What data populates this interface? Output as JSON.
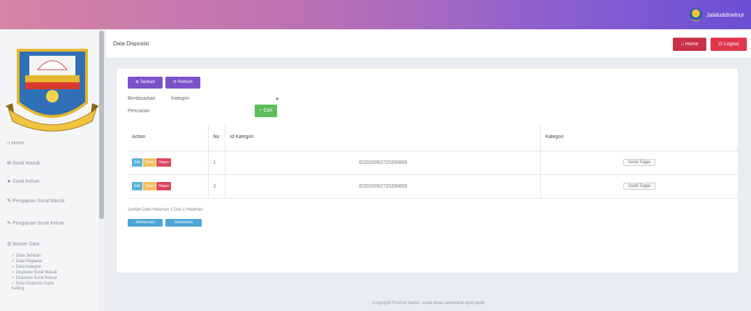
{
  "header": {
    "username": "Jalaluddinelnur"
  },
  "sidebar": {
    "nav": [
      {
        "label": "Home"
      },
      {
        "label": "Surat Masuk"
      },
      {
        "label": "Surat Keluar"
      },
      {
        "label": "Pengajuan Surat Masuk"
      },
      {
        "label": "Pengajuan Surat Keluar"
      },
      {
        "label": "Master Data"
      }
    ],
    "sub": [
      {
        "label": "Data Jabatan"
      },
      {
        "label": "Data Pegawai"
      },
      {
        "label": "Data Kategori"
      },
      {
        "label": "Disposisi Surat Masuk"
      },
      {
        "label": "Disposisi Surat Keluar"
      },
      {
        "label": "Data Disposisi Surat"
      },
      {
        "label": "Setting"
      }
    ]
  },
  "page": {
    "title": "Data Disposisi",
    "home_label": "Home",
    "logout_label": "Logout"
  },
  "toolbar": {
    "tambah_label": "Tambah",
    "refresh_label": "Refresh"
  },
  "filter": {
    "berdasarkan_label": "Berdasarkan",
    "selected": "Kategori",
    "pencarian_label": "Pencarian",
    "cari_label": "Cari"
  },
  "table": {
    "headers": [
      "Action",
      "No",
      "Id Kategori",
      "Kategori"
    ],
    "action_labels": {
      "edit": "Edit",
      "detail": "Detail",
      "delete": "Hapus"
    },
    "rows": [
      {
        "no": "1",
        "id": "ID2020062720200805",
        "kategori": "Surat Tugas"
      },
      {
        "no": "2",
        "id": "ID2020062720200805",
        "kategori": "Surat Tugas"
      }
    ]
  },
  "footer": {
    "summary": "Jumlah Data Halaman 1 Dari 1 Halaman",
    "prev_label": "Sebelumnya",
    "next_label": "Selanjutnya",
    "copyright": "Copyright Provinsi Jambi - surat dinas sekretariat dprd jambi"
  }
}
